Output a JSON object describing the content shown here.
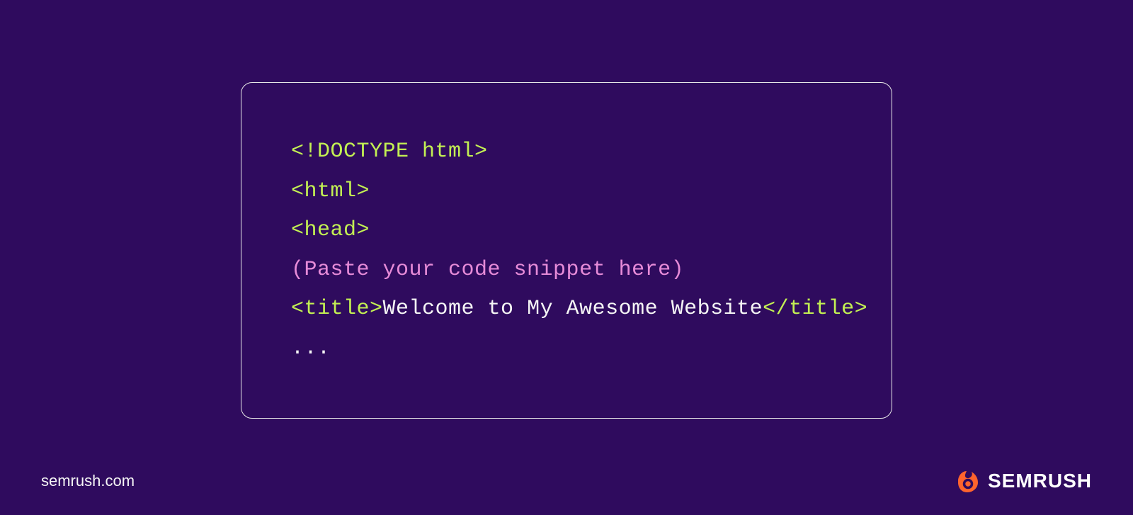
{
  "code": {
    "line1": "<!DOCTYPE html>",
    "line2": "<html>",
    "line3": "<head>",
    "line4": "(Paste your code snippet here)",
    "line5_open": "<title>",
    "line5_content": "Welcome to My Awesome Website",
    "line5_close": "</title>",
    "line6": "..."
  },
  "footer": {
    "url": "semrush.com",
    "brand": "SEMRUSH"
  },
  "colors": {
    "background": "#2f0b5e",
    "lime": "#c3f053",
    "pink": "#e68bd8",
    "white": "#f5f5f5",
    "orange": "#ff642d"
  }
}
